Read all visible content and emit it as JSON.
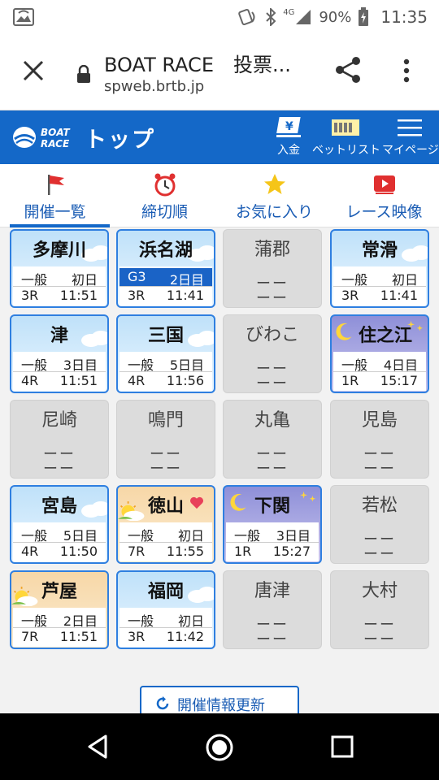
{
  "status": {
    "battery": "90%",
    "time": "11:35",
    "network": "4G"
  },
  "browser": {
    "title": "BOAT RACE　投票...",
    "url": "spweb.brtb.jp"
  },
  "app": {
    "page_title": "トップ",
    "deposit_label": "入金",
    "betlist_label": "ベットリスト",
    "mypage_label": "マイページ"
  },
  "tabs": [
    {
      "label": "開催一覧",
      "icon": "flag-icon",
      "active": true
    },
    {
      "label": "締切順",
      "icon": "alarm-clock-icon"
    },
    {
      "label": "お気に入り",
      "icon": "star-icon"
    },
    {
      "label": "レース映像",
      "icon": "video-play-icon"
    }
  ],
  "venues": [
    {
      "name": "多摩川",
      "grade": "一般",
      "day": "初日",
      "race": "3R",
      "time": "11:51"
    },
    {
      "name": "浜名湖",
      "grade": "G3",
      "day": "2日目",
      "race": "3R",
      "time": "11:41"
    },
    {
      "name": "蒲郡",
      "dash1": "ーー",
      "dash2": "ーー"
    },
    {
      "name": "常滑",
      "grade": "一般",
      "day": "初日",
      "race": "3R",
      "time": "11:41"
    },
    {
      "name": "津",
      "grade": "一般",
      "day": "3日目",
      "race": "4R",
      "time": "11:51"
    },
    {
      "name": "三国",
      "grade": "一般",
      "day": "5日目",
      "race": "4R",
      "time": "11:56"
    },
    {
      "name": "びわこ",
      "dash1": "ーー",
      "dash2": "ーー"
    },
    {
      "name": "住之江",
      "grade": "一般",
      "day": "4日目",
      "race": "1R",
      "time": "15:17"
    },
    {
      "name": "尼崎",
      "dash1": "ーー",
      "dash2": "ーー"
    },
    {
      "name": "鳴門",
      "dash1": "ーー",
      "dash2": "ーー"
    },
    {
      "name": "丸亀",
      "dash1": "ーー",
      "dash2": "ーー"
    },
    {
      "name": "児島",
      "dash1": "ーー",
      "dash2": "ーー"
    },
    {
      "name": "宮島",
      "grade": "一般",
      "day": "5日目",
      "race": "4R",
      "time": "11:50"
    },
    {
      "name": "徳山",
      "grade": "一般",
      "day": "初日",
      "race": "7R",
      "time": "11:55"
    },
    {
      "name": "下関",
      "grade": "一般",
      "day": "3日目",
      "race": "1R",
      "time": "15:27"
    },
    {
      "name": "若松",
      "dash1": "ーー",
      "dash2": "ーー"
    },
    {
      "name": "芦屋",
      "grade": "一般",
      "day": "2日目",
      "race": "7R",
      "time": "11:51"
    },
    {
      "name": "福岡",
      "grade": "一般",
      "day": "初日",
      "race": "3R",
      "time": "11:42"
    },
    {
      "name": "唐津",
      "dash1": "ーー",
      "dash2": "ーー"
    },
    {
      "name": "大村",
      "dash1": "ーー",
      "dash2": "ーー"
    }
  ],
  "refresh_label": "開催情報更新",
  "colors": {
    "primary": "#1468c8",
    "day_card": "#bfe1f9",
    "night_card": "#8e8fd8",
    "morning_card": "#f7d7a7",
    "closed_card": "#dcdcdc",
    "g3_badge": "#1a63c6"
  }
}
